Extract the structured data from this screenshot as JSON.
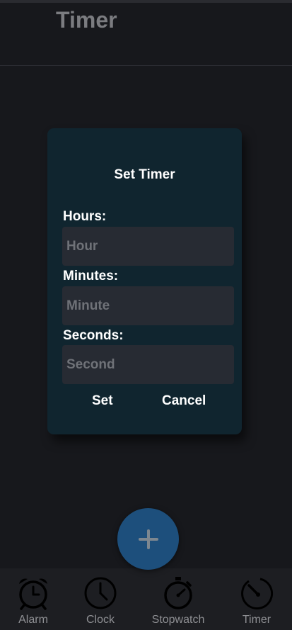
{
  "header": {
    "title": "Timer"
  },
  "dialog": {
    "title": "Set Timer",
    "fields": [
      {
        "label": "Hours:",
        "placeholder": "Hour",
        "value": ""
      },
      {
        "label": "Minutes:",
        "placeholder": "Minute",
        "value": ""
      },
      {
        "label": "Seconds:",
        "placeholder": "Second",
        "value": ""
      }
    ],
    "set_label": "Set",
    "cancel_label": "Cancel"
  },
  "fab": {
    "icon": "plus-icon"
  },
  "nav": {
    "items": [
      {
        "label": "Alarm",
        "icon": "alarm-clock-icon"
      },
      {
        "label": "Clock",
        "icon": "clock-icon"
      },
      {
        "label": "Stopwatch",
        "icon": "stopwatch-icon"
      },
      {
        "label": "Timer",
        "icon": "timer-icon"
      }
    ]
  },
  "colors": {
    "background": "#17181c",
    "dialog": "#10252f",
    "input": "#272b33",
    "fab": "#1d4f7c",
    "nav": "#1d1e22"
  }
}
